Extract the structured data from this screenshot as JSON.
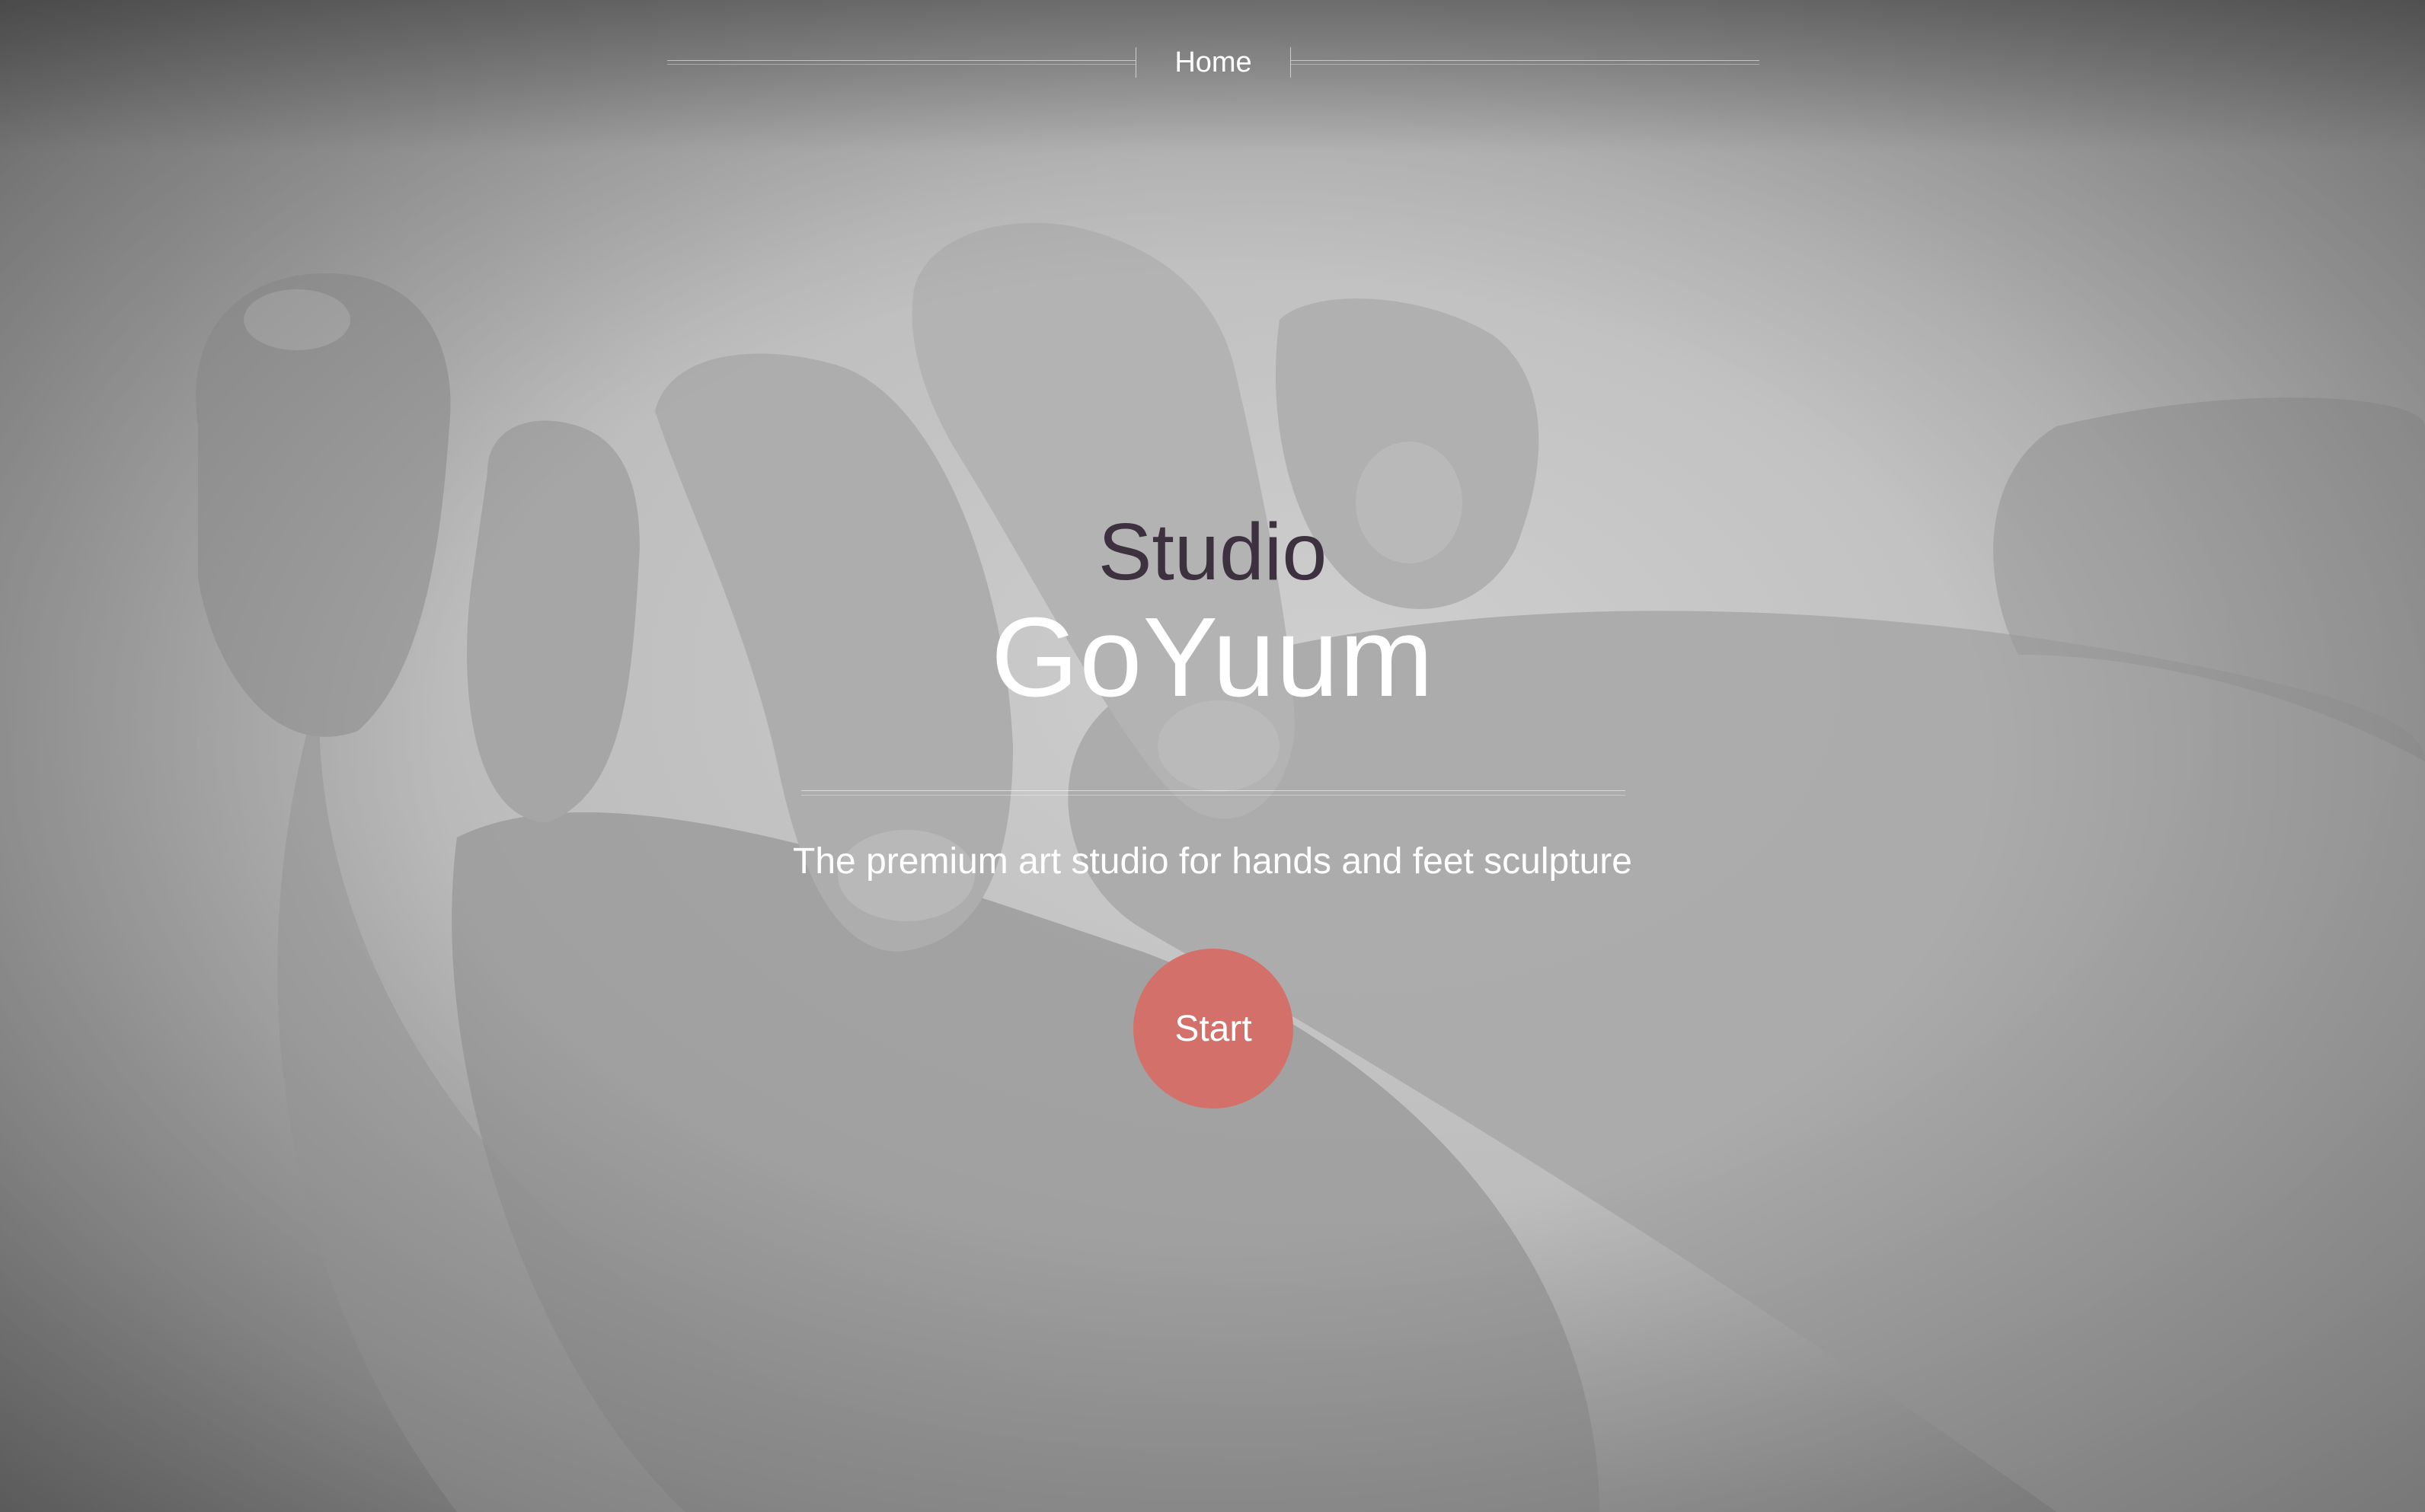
{
  "nav": {
    "items": [
      {
        "label": "Home"
      }
    ]
  },
  "hero": {
    "eyebrow": "Studio",
    "title": "GoYuum",
    "tagline": "The premium art studio for hands and feet sculpture",
    "cta_label": "Start"
  },
  "colors": {
    "eyebrow": "#3d3140",
    "cta_background": "#d4706a",
    "text": "#ffffff"
  },
  "background": {
    "icon": "baby-hand-photo",
    "style": "grayscale"
  }
}
